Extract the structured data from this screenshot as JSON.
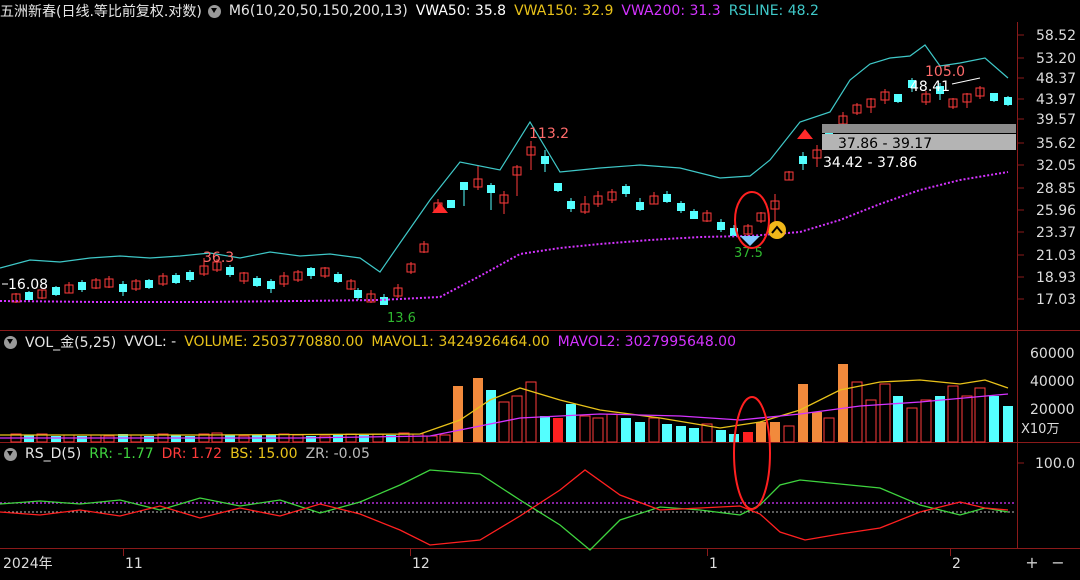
{
  "main": {
    "title": "五洲新春(日线.等比前复权.对数)",
    "indicator": "M6(10,20,50,150,200,13)",
    "vwa50": "VWA50: 35.8",
    "vwa150": "VWA150: 32.9",
    "vwa200": "VWA200: 31.3",
    "rsline": "RSLINE: 48.2",
    "price_axis": [
      "58.52",
      "53.20",
      "48.37",
      "43.97",
      "39.57",
      "35.62",
      "32.05",
      "28.85",
      "25.96",
      "23.37",
      "21.03",
      "18.93",
      "17.03"
    ],
    "annotations": {
      "left_low": "16.08",
      "p36": "36.3",
      "p113": "113.2",
      "p105": "105.0",
      "p48": "48.41",
      "range1": "37.86 - 39.17",
      "range2": "34.42 - 37.86",
      "low_a": "13.6",
      "low_b": "37.5"
    }
  },
  "volume": {
    "title": "VOL_金(5,25)",
    "vvol": "VVOL: -",
    "volume": "VOLUME: 2503770880.00",
    "mavol1": "MAVOL1: 3424926464.00",
    "mavol2": "MAVOL2: 3027995648.00",
    "axis": [
      "60000",
      "40000",
      "20000"
    ],
    "unit": "X10万"
  },
  "rs": {
    "title": "RS_D(5)",
    "rr": "RR: -1.77",
    "dr": "DR: 1.72",
    "bs": "BS: 15.00",
    "zr": "ZR: -0.05",
    "axis": "100.0"
  },
  "time_axis": {
    "labels": [
      "2024年",
      "11",
      "12",
      "1",
      "2"
    ]
  },
  "buttons": {
    "plus": "+",
    "minus": "−"
  },
  "colors": {
    "up": "#ff3b3b",
    "down": "#54ffff",
    "vwa50": "#ffffff",
    "vwa150": "#e8c21a",
    "vwa200": "#d433ff",
    "rsline": "#3fc8c8"
  }
}
